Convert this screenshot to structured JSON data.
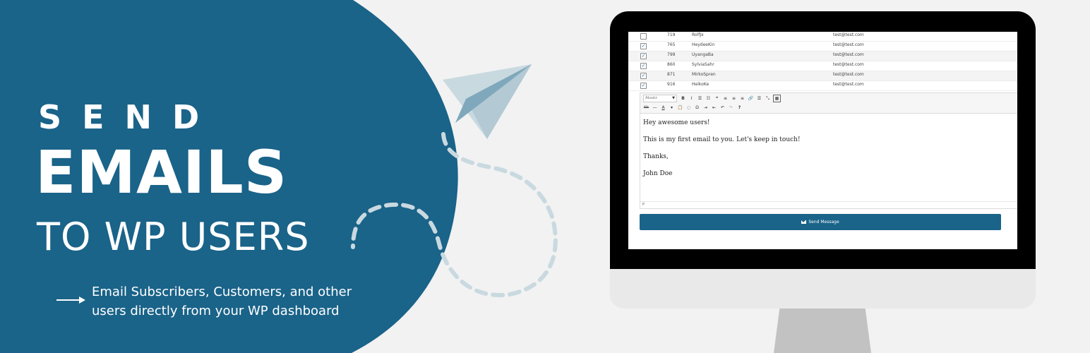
{
  "headline": {
    "line1": "SEND",
    "line2": "EMAILS",
    "line3": "TO WP USERS"
  },
  "subtitle": {
    "line1": "Email Subscribers, Customers, and other",
    "line2": "users directly from your WP dashboard"
  },
  "colors": {
    "brand_blue": "#1a6389",
    "plane_light": "#c9d9e0",
    "plane_dark": "#7fa8bc",
    "dash": "#c9d9e0"
  },
  "icons": [
    "arrow-right-icon",
    "paper-plane-icon",
    "mail-icon"
  ],
  "table": {
    "rows": [
      {
        "checked": false,
        "id": "719",
        "name": "RolfJx",
        "email": "test@test.com"
      },
      {
        "checked": true,
        "id": "765",
        "name": "HeydeeKin",
        "email": "test@test.com"
      },
      {
        "checked": true,
        "id": "799",
        "name": "UyangaBa",
        "email": "test@test.com"
      },
      {
        "checked": true,
        "id": "860",
        "name": "SylviaSahr",
        "email": "test@test.com"
      },
      {
        "checked": true,
        "id": "871",
        "name": "MirkoSpren",
        "email": "test@test.com"
      },
      {
        "checked": true,
        "id": "916",
        "name": "HeikoKe",
        "email": "test@test.com"
      }
    ]
  },
  "editor": {
    "format": "Absatz",
    "toolbar_row1": [
      "B",
      "I",
      "☰",
      "☷",
      "❝",
      "≡",
      "≡",
      "≡",
      "🔗",
      "☰",
      "⤡",
      "▦"
    ],
    "toolbar_row2": [
      "ᴬᴮᶜ",
      "—",
      "A",
      "▾",
      "📋",
      "◌",
      "Ω",
      "⇥",
      "⇤",
      "↶",
      "↷",
      "?"
    ],
    "content": {
      "p1": "Hey awesome users!",
      "p2": "This is my first email to you. Let's keep in touch!",
      "p3": "Thanks,",
      "p4": "John Doe"
    },
    "statusbar": "P"
  },
  "send_button": {
    "label": "Send Message"
  }
}
